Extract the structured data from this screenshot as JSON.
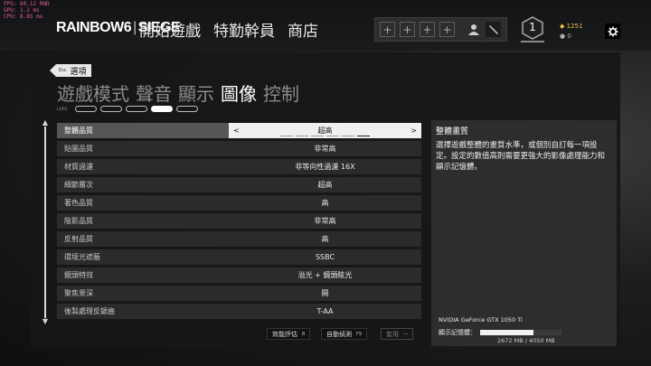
{
  "debug_overlay": [
    "FPS: 60.12 RND",
    "GPU: 1.2 ms",
    "CPU: 8.85 ms"
  ],
  "topbar": {
    "logo_left": "RAINBOW",
    "logo_six": "6",
    "logo_right": "SIEGE",
    "nav": [
      "開始遊戲",
      "特勤幹員",
      "商店"
    ],
    "squad_slots": [
      "+",
      "+",
      "+",
      "+"
    ],
    "level": "1",
    "r6_credits": "1251",
    "renown": "0",
    "icons": {
      "profile": "user-icon",
      "tool": "knife-icon",
      "settings": "gear-icon",
      "credits": "r6-credit-icon",
      "renown": "renown-icon"
    }
  },
  "back_button": {
    "key": "Esc",
    "label": "選項"
  },
  "tabs": [
    {
      "label": "遊戲模式",
      "active": false
    },
    {
      "label": "聲音",
      "active": false
    },
    {
      "label": "顯示",
      "active": false
    },
    {
      "label": "圖像",
      "active": true
    },
    {
      "label": "控制",
      "active": false
    }
  ],
  "pager": {
    "key": "L1/R1",
    "count": 5,
    "active_index": 4
  },
  "settings": [
    {
      "label": "整體品質",
      "value": "超高",
      "selected": true
    },
    {
      "label": "貼圖品質",
      "value": "非常高"
    },
    {
      "label": "材質過濾",
      "value": "非等向性過濾 16X"
    },
    {
      "label": "細節層次",
      "value": "超高"
    },
    {
      "label": "著色品質",
      "value": "高"
    },
    {
      "label": "陰影品質",
      "value": "非常高"
    },
    {
      "label": "反射品質",
      "value": "高"
    },
    {
      "label": "環境光遮蔽",
      "value": "SSBC"
    },
    {
      "label": "鏡頭特效",
      "value": "溢光 + 鏡頭眩光"
    },
    {
      "label": "聚焦景深",
      "value": "開"
    },
    {
      "label": "後製處理反鋸齒",
      "value": "T-AA"
    }
  ],
  "quality_ticks": {
    "count": 6,
    "active_index": 5
  },
  "bottom_buttons": [
    {
      "label": "效能評估",
      "key": "B",
      "enabled": true
    },
    {
      "label": "自動偵測",
      "key": "F9",
      "enabled": true
    },
    {
      "label": "套用",
      "key": "---",
      "enabled": false
    }
  ],
  "info": {
    "title": "整體畫質",
    "description": "選擇遊戲整體的畫質水準，或個別自訂每一項設定。設定的數值高則需要更強大的影像處理能力和顯示記憶體。"
  },
  "gpu": {
    "name": "NVIDIA GeForce GTX 1050 Ti",
    "memory_label": "顯示記憶體：",
    "memory_text": "2672 MB / 4050 MB",
    "memory_used_fraction": 0.66
  }
}
